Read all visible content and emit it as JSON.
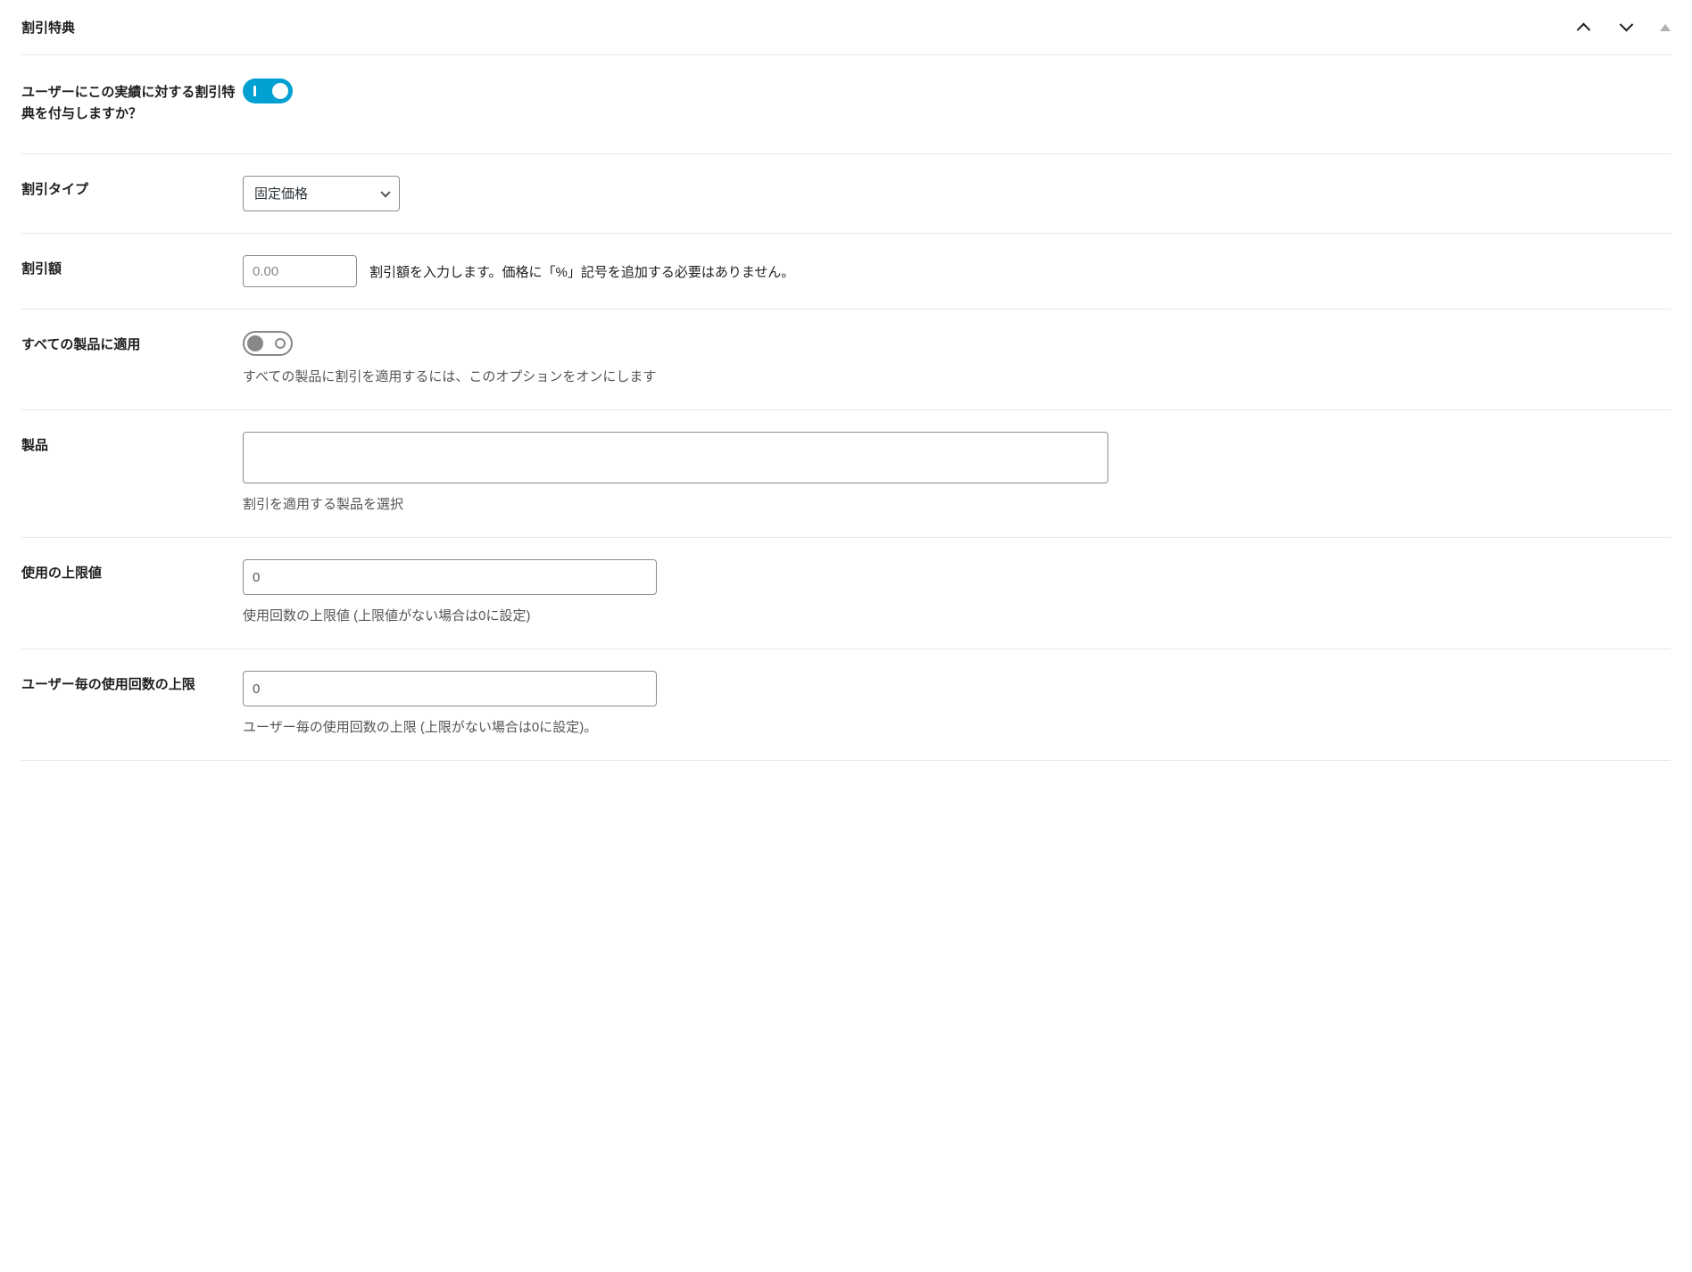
{
  "panel": {
    "title": "割引特典"
  },
  "fields": {
    "grant_discount": {
      "label": "ユーザーにこの実績に対する割引特典を付与しますか？",
      "value": true
    },
    "discount_type": {
      "label": "割引タイプ",
      "selected": "固定価格",
      "options": [
        "固定価格"
      ]
    },
    "discount_amount": {
      "label": "割引額",
      "placeholder": "0.00",
      "help": "割引額を入力します。価格に「%」記号を追加する必要はありません。"
    },
    "apply_all_products": {
      "label": "すべての製品に適用",
      "value": false,
      "help": "すべての製品に割引を適用するには、このオプションをオンにします"
    },
    "products": {
      "label": "製品",
      "help": "割引を適用する製品を選択"
    },
    "usage_limit": {
      "label": "使用の上限値",
      "value": "0",
      "help": "使用回数の上限値 (上限値がない場合は0に設定)"
    },
    "usage_limit_per_user": {
      "label": "ユーザー毎の使用回数の上限",
      "value": "0",
      "help": "ユーザー毎の使用回数の上限 (上限がない場合は0に設定)。"
    }
  }
}
